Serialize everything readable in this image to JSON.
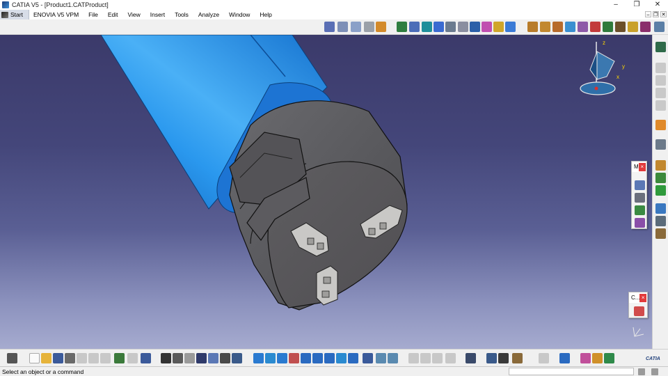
{
  "window": {
    "title": "CATIA V5 - [Product1.CATProduct]",
    "controls": [
      "–",
      "❐",
      "✕"
    ]
  },
  "menu": {
    "items": [
      "Start",
      "ENOVIA V5 VPM",
      "File",
      "Edit",
      "View",
      "Insert",
      "Tools",
      "Analyze",
      "Window",
      "Help"
    ],
    "mdi_controls": [
      "–",
      "❐",
      "✕"
    ]
  },
  "compass": {
    "x_label": "x",
    "y_label": "y",
    "z_label": "z"
  },
  "floating_toolbars": [
    {
      "title": "M",
      "close": "×"
    },
    {
      "title": "C...",
      "close": "×"
    }
  ],
  "statusbar": {
    "message": "Select an object or a command",
    "command_value": ""
  },
  "branding": {
    "logo_text": "CATIA"
  },
  "colors": {
    "viewport_top": "#3b3a6a",
    "viewport_bottom": "#a6abcf",
    "tube_blue": "#1e86e6",
    "part_gray": "#5b5b5e",
    "close_red": "#e23b3b"
  }
}
